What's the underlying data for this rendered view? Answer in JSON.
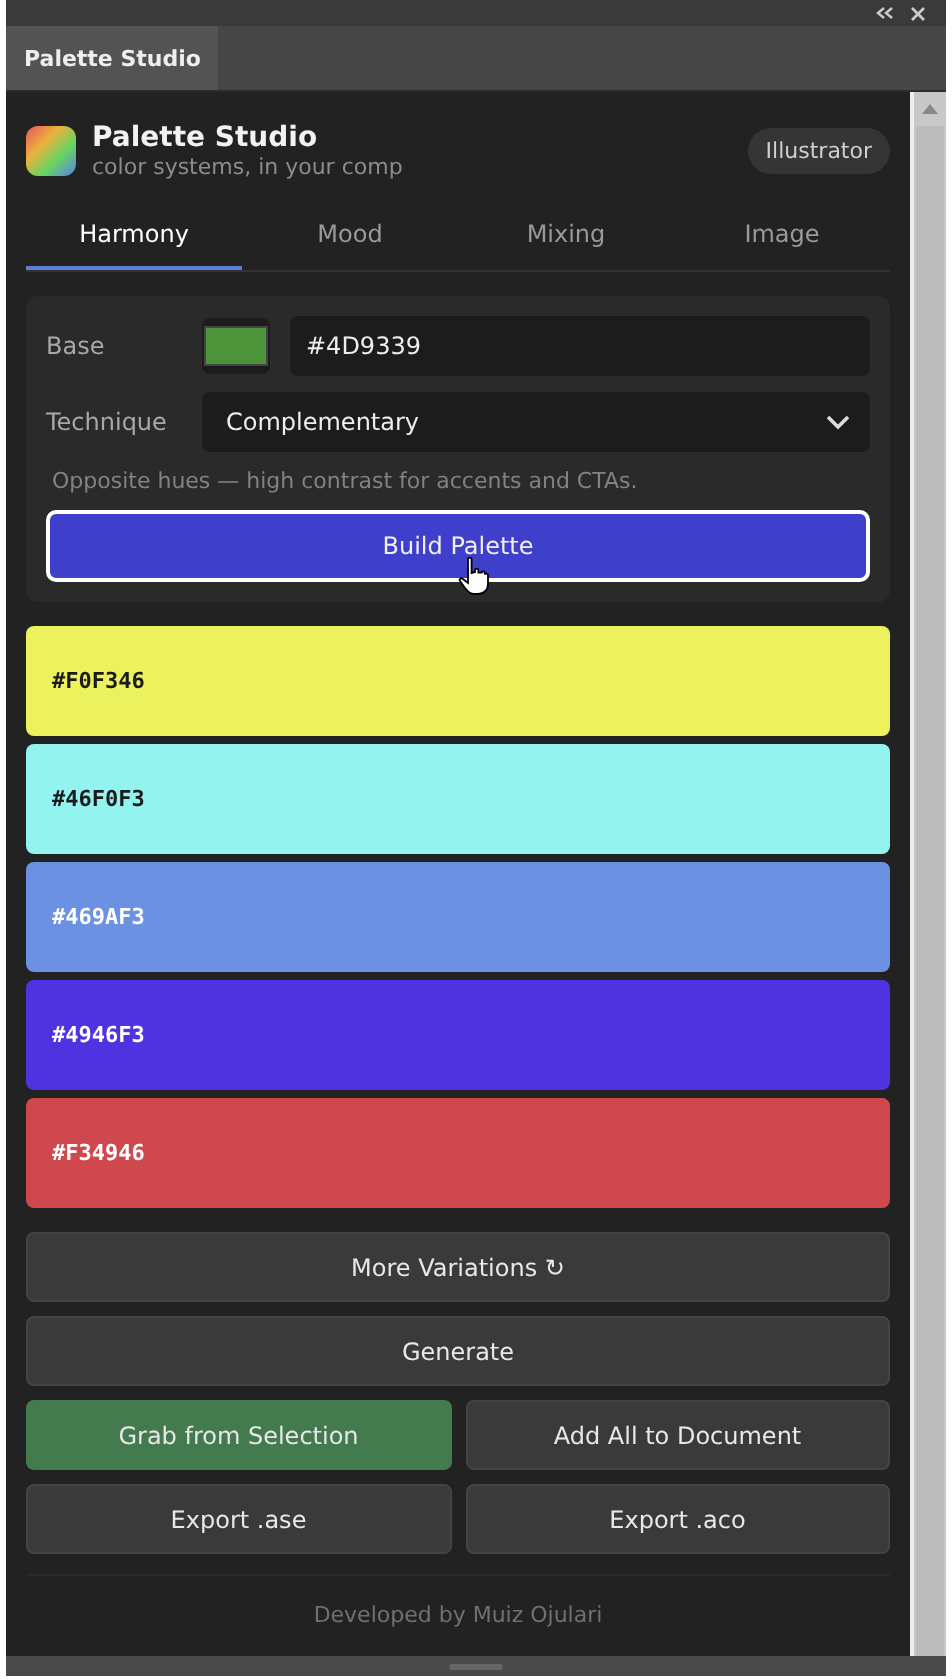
{
  "panel_tab": {
    "label": "Palette Studio"
  },
  "header": {
    "title": "Palette Studio",
    "subtitle": "color systems, in your comp",
    "badge": "Illustrator"
  },
  "tabs": [
    {
      "label": "Harmony",
      "selected": true
    },
    {
      "label": "Mood",
      "selected": false
    },
    {
      "label": "Mixing",
      "selected": false
    },
    {
      "label": "Image",
      "selected": false
    }
  ],
  "controls": {
    "base_label": "Base",
    "base_value": "#4D9339",
    "technique_label": "Technique",
    "technique_value": "Complementary",
    "hint": "Opposite hues — high contrast for accents and CTAs.",
    "build_button": "Build Palette"
  },
  "swatches": [
    {
      "label": "#F0F346",
      "color": "#ebf25e"
    },
    {
      "label": "#46F0F3",
      "color": "#92f3ef"
    },
    {
      "label": "#469AF3",
      "color": "#6c91e3"
    },
    {
      "label": "#4946F3",
      "color": "#5033e0"
    },
    {
      "label": "#F34946",
      "color": "#cf484e"
    }
  ],
  "button_rows": [
    [
      {
        "label": "More Variations ↻",
        "kind": "plain"
      }
    ],
    [
      {
        "label": "Generate",
        "kind": "plain"
      }
    ],
    [
      {
        "label": "Grab from Selection",
        "kind": "accent"
      },
      {
        "label": "Add All to Document",
        "kind": "plain"
      }
    ],
    [
      {
        "label": "Export .ase",
        "kind": "plain"
      },
      {
        "label": "Export .aco",
        "kind": "plain"
      }
    ]
  ],
  "footer": "Developed by Muiz Ojulari"
}
